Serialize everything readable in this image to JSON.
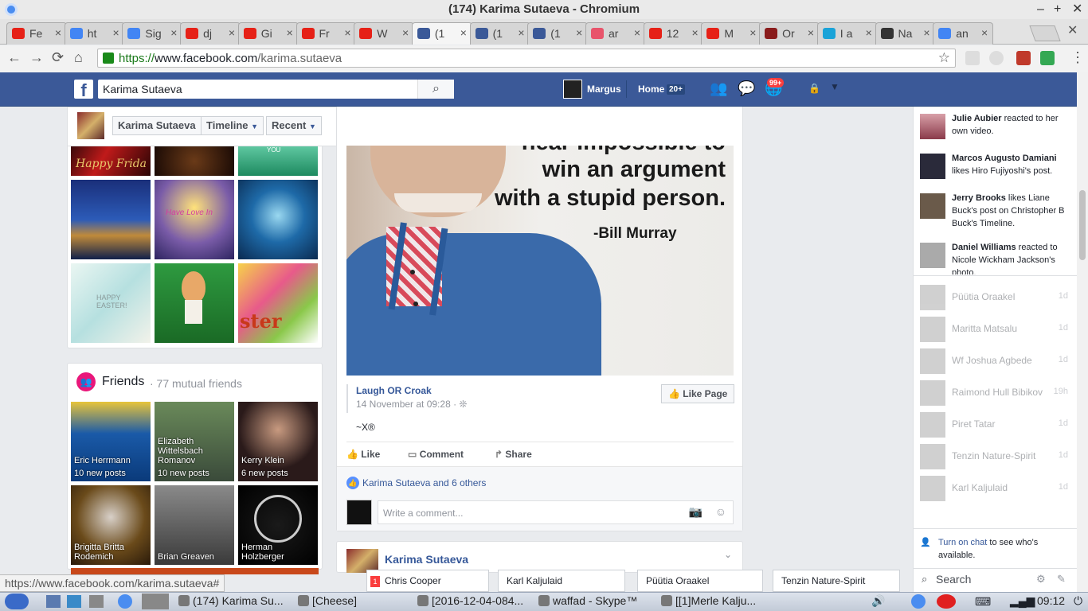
{
  "window": {
    "title": "(174) Karima Sutaeva - Chromium",
    "minimize": "–",
    "maximize": "+",
    "close": "✕"
  },
  "tabs": [
    {
      "label": "Fe",
      "icon": "youtube-icon",
      "color": "#e62117"
    },
    {
      "label": "ht",
      "icon": "google-icon",
      "color": "#4285f4"
    },
    {
      "label": "Sig",
      "icon": "google-icon",
      "color": "#4285f4"
    },
    {
      "label": "dj",
      "icon": "youtube-icon",
      "color": "#e62117"
    },
    {
      "label": "Gi",
      "icon": "youtube-icon",
      "color": "#e62117"
    },
    {
      "label": "Fr",
      "icon": "youtube-icon",
      "color": "#e62117"
    },
    {
      "label": "W",
      "icon": "youtube-icon",
      "color": "#e62117"
    },
    {
      "label": "(1",
      "icon": "facebook-icon",
      "color": "#3b5998"
    },
    {
      "label": "(1",
      "icon": "facebook-icon",
      "color": "#3b5998"
    },
    {
      "label": "(1",
      "icon": "facebook-icon",
      "color": "#3b5998"
    },
    {
      "label": "ar",
      "icon": "heart-icon",
      "color": "#e8546b"
    },
    {
      "label": "12",
      "icon": "youtube-icon",
      "color": "#e62117"
    },
    {
      "label": "M",
      "icon": "youtube-icon",
      "color": "#e62117"
    },
    {
      "label": "Or",
      "icon": "quora-icon",
      "color": "#8a1c1c"
    },
    {
      "label": "I a",
      "icon": "snowflake-icon",
      "color": "#1aa3d8"
    },
    {
      "label": "Na",
      "icon": "wikipedia-icon",
      "color": "#333333"
    },
    {
      "label": "an",
      "icon": "google-icon",
      "color": "#4285f4"
    }
  ],
  "omnibox": {
    "scheme": "https://",
    "host": "www.facebook.com",
    "path": "/karima.sutaeva"
  },
  "fb": {
    "logo": "f",
    "search_value": "Karima Sutaeva",
    "user_name": "Margus",
    "home_label": "Home",
    "home_badge": "20+",
    "notif_badge": "99+"
  },
  "profile_nav": {
    "name": "Karima Sutaeva",
    "timeline": "Timeline",
    "recent": "Recent"
  },
  "friends": {
    "title": "Friends",
    "mutual": "· 77 mutual friends",
    "items": [
      {
        "name": "Eric Herrmann",
        "posts": "10 new posts"
      },
      {
        "name": "Elizabeth Wittelsbach Romanov",
        "posts": "10 new posts"
      },
      {
        "name": "Kerry Klein",
        "posts": "6 new posts"
      },
      {
        "name": "Brigitta Britta Rodemich",
        "posts": ""
      },
      {
        "name": "Brian Greaven",
        "posts": ""
      },
      {
        "name": "Herman Holzberger",
        "posts": ""
      }
    ]
  },
  "post": {
    "quote_line1": "near impossible to",
    "quote_line2": "win an argument",
    "quote_line3": "with a stupid person.",
    "quote_author": "-Bill Murray",
    "page_name": "Laugh OR Croak",
    "date": "14 November at 09:28 ·",
    "like_page": "Like Page",
    "text": "~X®",
    "like": "Like",
    "comment": "Comment",
    "share": "Share",
    "reactions": "Karima Sutaeva and 6 others",
    "comment_placeholder": "Write a comment..."
  },
  "next_post": {
    "author": "Karima Sutaeva"
  },
  "ticker": [
    {
      "name": "Julie Aubier",
      "rest": " reacted to her own video."
    },
    {
      "name": "Marcos Augusto Damiani",
      "rest": " likes Hiro Fujiyoshi's post."
    },
    {
      "name": "Jerry Brooks",
      "rest": " likes Liane Buck's post on Christopher B Buck's Timeline."
    },
    {
      "name": "Daniel Williams",
      "rest": " reacted to Nicole Wickham Jackson's photo."
    }
  ],
  "chat_list": [
    {
      "name": "Püütia Oraakel",
      "time": "1d"
    },
    {
      "name": "Maritta Matsalu",
      "time": "1d"
    },
    {
      "name": "Wf Joshua Agbede",
      "time": "1d"
    },
    {
      "name": "Raimond Hull Bibikov",
      "time": "19h"
    },
    {
      "name": "Piret Tatar",
      "time": "1d"
    },
    {
      "name": "Tenzin Nature-Spirit",
      "time": "1d"
    },
    {
      "name": "Karl Kaljulaid",
      "time": "1d"
    }
  ],
  "chat_footer": {
    "link": "Turn on chat",
    "rest": " to see who's available.",
    "search": "Search"
  },
  "chat_tabs": [
    {
      "name": "Chris Cooper",
      "badge": "1"
    },
    {
      "name": "Karl Kaljulaid",
      "badge": ""
    },
    {
      "name": "Püütia Oraakel",
      "badge": ""
    },
    {
      "name": "Tenzin Nature-Spirit",
      "badge": ""
    }
  ],
  "status_url": "https://www.facebook.com/karima.sutaeva#",
  "taskbar": {
    "items": [
      "(174) Karima Su...",
      "[Cheese]",
      "[2016-12-04-084...",
      "waffad - Skype™",
      "[[1]Merle Kalju..."
    ],
    "clock": "09:12"
  }
}
